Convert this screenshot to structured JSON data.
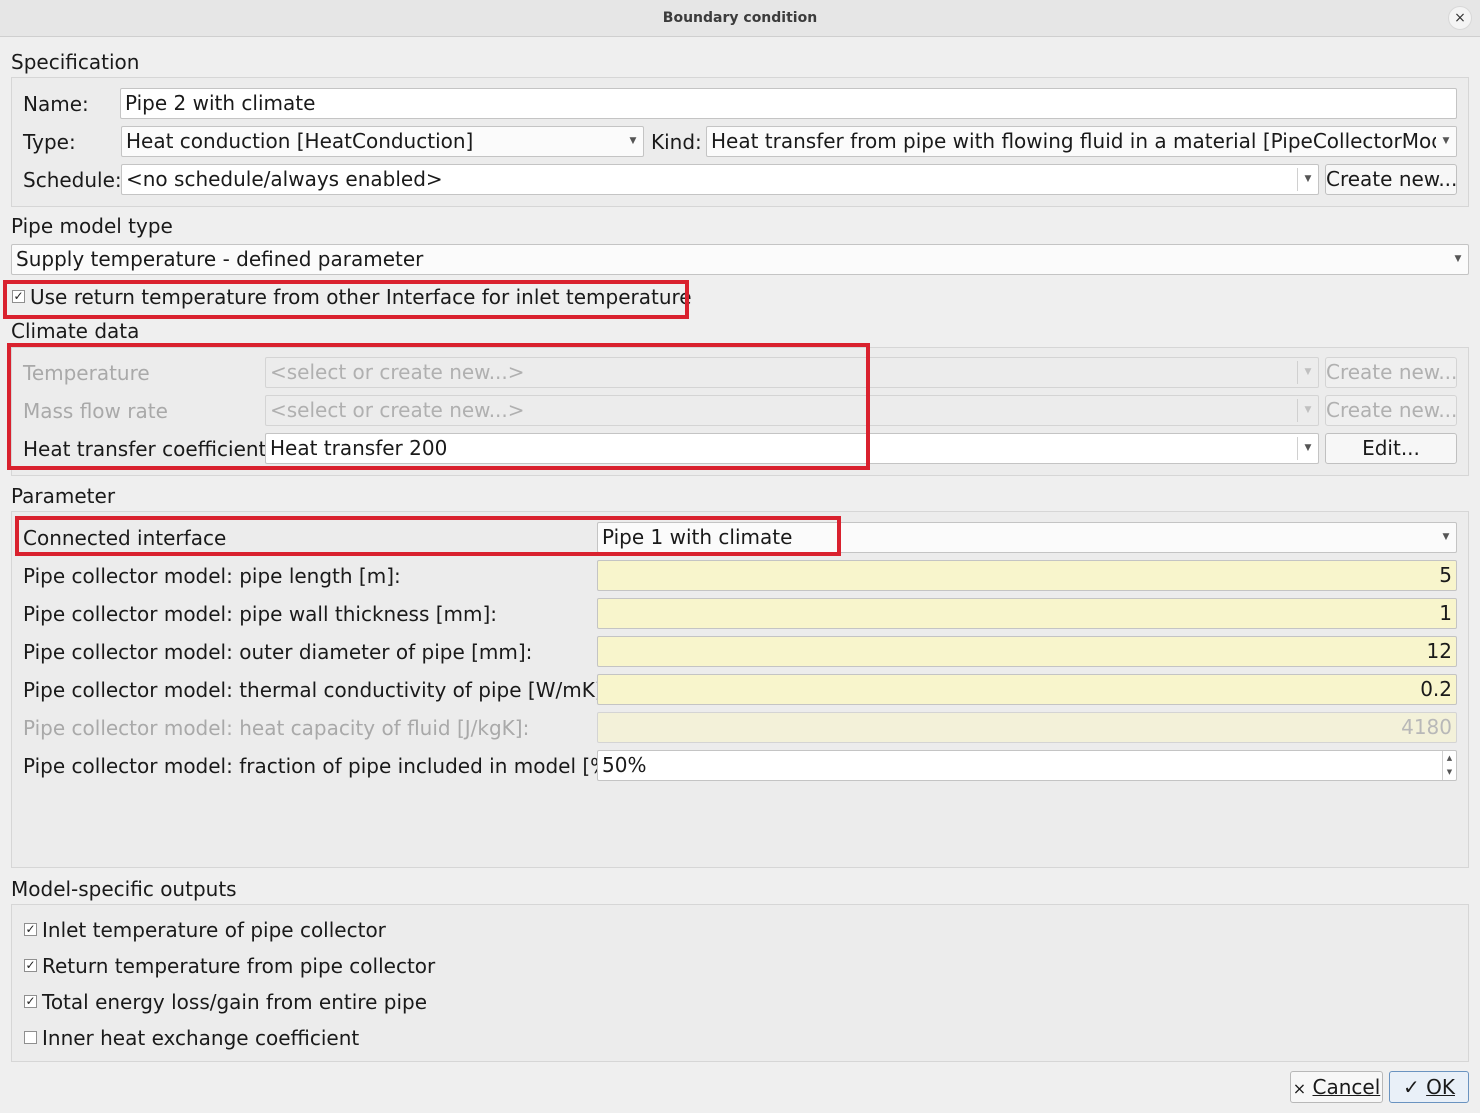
{
  "window": {
    "title": "Boundary condition",
    "close_icon": "×"
  },
  "specification": {
    "section_title": "Specification",
    "name_label": "Name:",
    "name_value": "Pipe 2 with climate",
    "type_label": "Type:",
    "type_value": "Heat conduction [HeatConduction]",
    "kind_label": "Kind:",
    "kind_value": "Heat transfer from pipe with flowing fluid in a material [PipeCollectorModel]",
    "schedule_label": "Schedule:",
    "schedule_value": "<no schedule/always enabled>",
    "create_new_label": "Create new..."
  },
  "pipe_model": {
    "section_title": "Pipe model type",
    "value": "Supply temperature - defined parameter",
    "use_return_checkbox_label": "Use return temperature from other Interface for inlet temperature",
    "use_return_checked": true
  },
  "climate": {
    "section_title": "Climate data",
    "temperature_label": "Temperature",
    "temperature_value": "<select or create new...>",
    "temperature_button": "Create new...",
    "mass_flow_label": "Mass flow rate",
    "mass_flow_value": "<select or create new...>",
    "mass_flow_button": "Create new...",
    "htc_label": "Heat transfer coefficient",
    "htc_value": "Heat transfer 200",
    "htc_button": "Edit..."
  },
  "parameter": {
    "section_title": "Parameter",
    "connected_interface_label": "Connected interface",
    "connected_interface_value": "Pipe 1 with climate",
    "rows": [
      {
        "label": "Pipe collector model: pipe length [m]:",
        "value": "5",
        "enabled": true
      },
      {
        "label": "Pipe collector model: pipe wall thickness [mm]:",
        "value": "1",
        "enabled": true
      },
      {
        "label": "Pipe collector model: outer diameter of pipe [mm]:",
        "value": "12",
        "enabled": true
      },
      {
        "label": "Pipe collector model: thermal conductivity of pipe [W/mK]:",
        "value": "0.2",
        "enabled": true
      },
      {
        "label": "Pipe collector model: heat capacity of fluid [J/kgK]:",
        "value": "4180",
        "enabled": false
      }
    ],
    "fraction_label": "Pipe collector model: fraction of pipe included in model [%]:",
    "fraction_value": "50%"
  },
  "outputs": {
    "section_title": "Model-specific outputs",
    "items": [
      {
        "label": "Inlet temperature of pipe collector",
        "checked": true
      },
      {
        "label": "Return temperature from pipe collector",
        "checked": true
      },
      {
        "label": "Total energy loss/gain from entire pipe",
        "checked": true
      },
      {
        "label": "Inner heat exchange coefficient",
        "checked": false
      }
    ]
  },
  "buttons": {
    "cancel_label": "Cancel",
    "cancel_icon": "×",
    "ok_label": "OK",
    "ok_icon": "✓"
  },
  "colors": {
    "highlight": "#d9212e",
    "input_yellow": "#f8f5cc"
  }
}
